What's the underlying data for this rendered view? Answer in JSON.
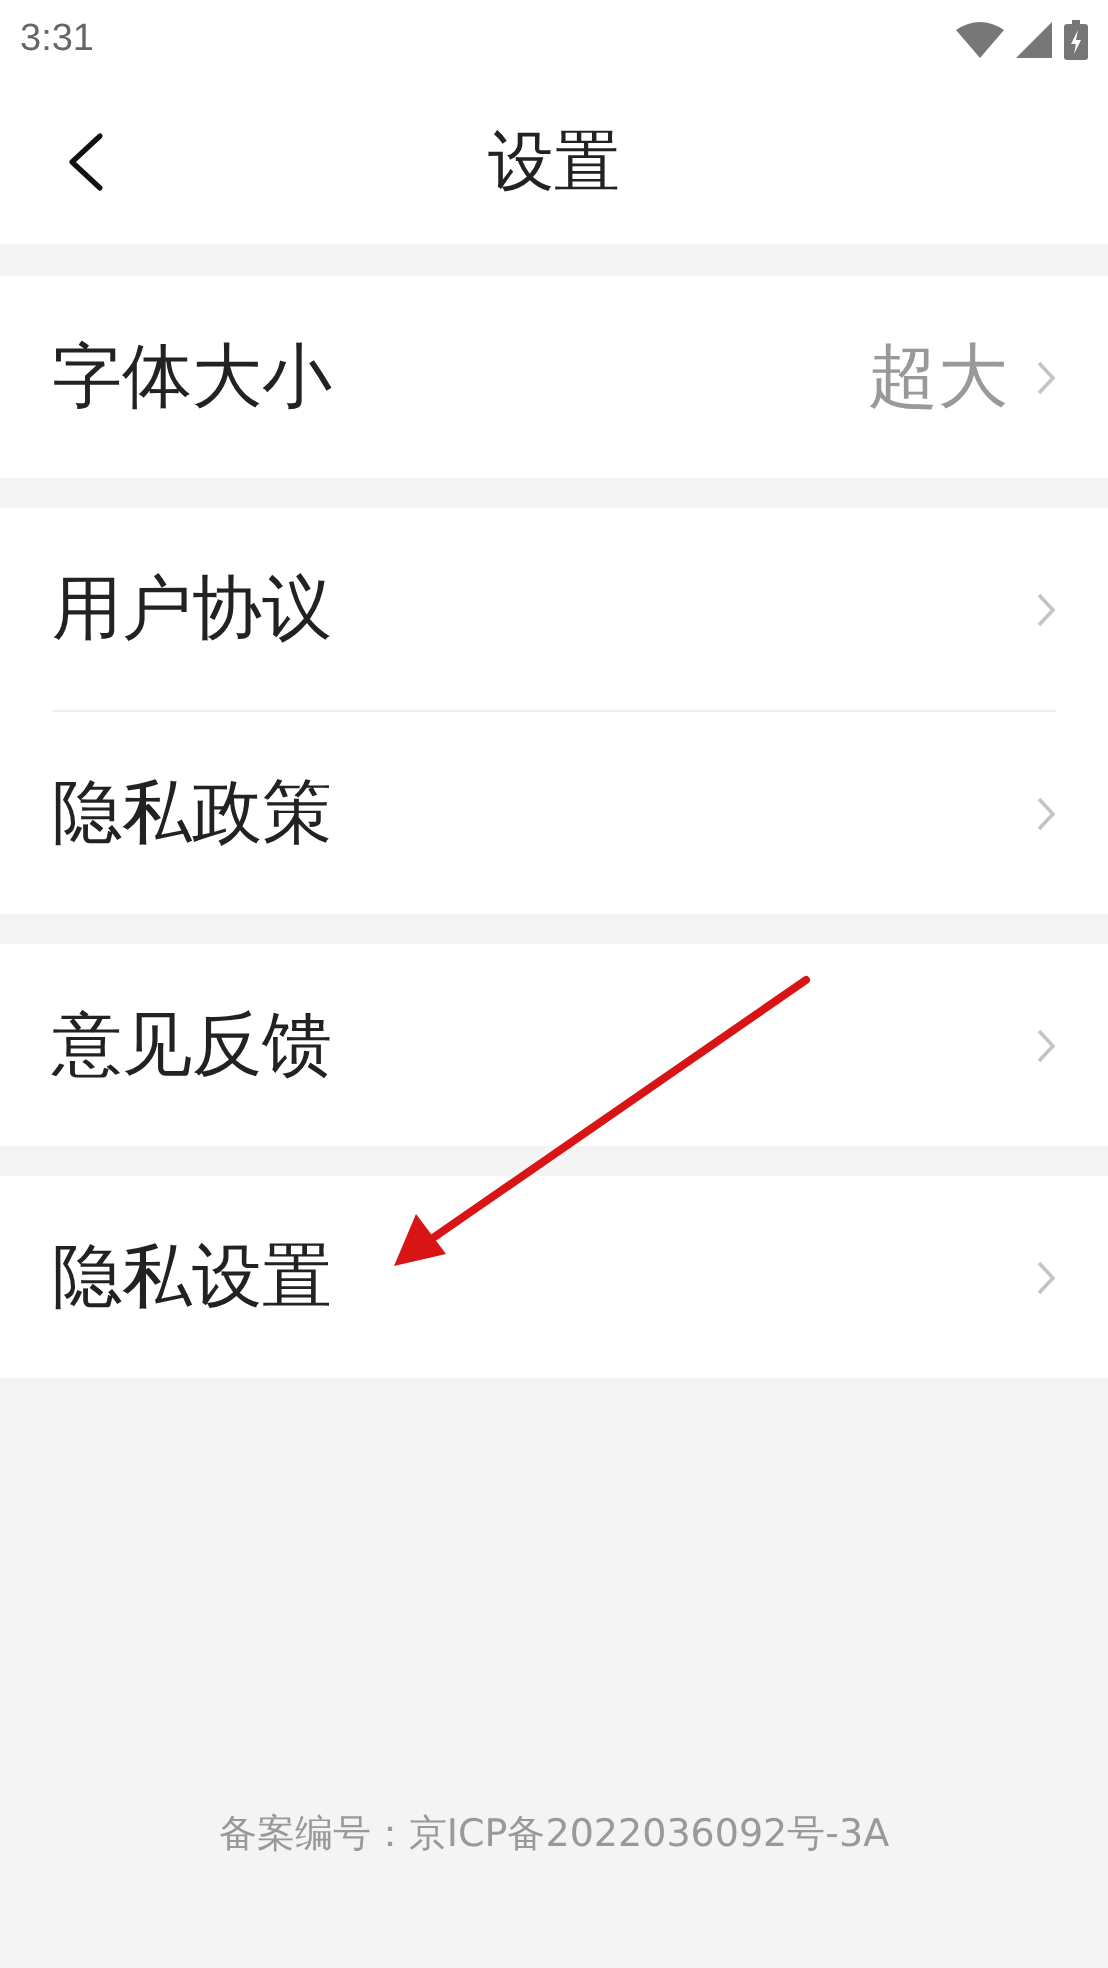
{
  "status_bar": {
    "time": "3:31"
  },
  "header": {
    "title": "设置"
  },
  "groups": [
    {
      "items": [
        {
          "label": "字体大小",
          "value": "超大"
        }
      ]
    },
    {
      "items": [
        {
          "label": "用户协议"
        },
        {
          "label": "隐私政策"
        }
      ]
    },
    {
      "items": [
        {
          "label": "意见反馈"
        }
      ]
    },
    {
      "items": [
        {
          "label": "隐私设置"
        }
      ]
    }
  ],
  "footer": {
    "text": "备案编号：京ICP备2022036092号-3A"
  }
}
